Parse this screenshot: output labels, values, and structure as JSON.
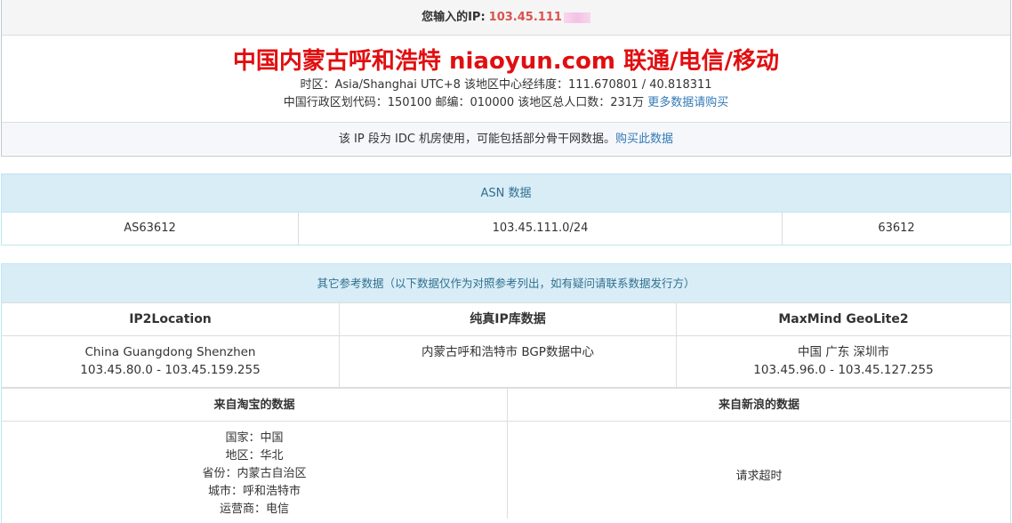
{
  "ip_header": {
    "label": "您输入的IP:",
    "value": "103.45.111"
  },
  "location": {
    "title": "中国内蒙古呼和浩特 niaoyun.com 联通/电信/移动",
    "timezone_line": "时区：Asia/Shanghai UTC+8 该地区中心经纬度：111.670801 / 40.818311",
    "code_line": "中国行政区划代码：150100 邮编：010000 该地区总人口数：231万",
    "more_link": "更多数据请购买"
  },
  "idc_note": {
    "text": "该 IP 段为 IDC 机房使用，可能包括部分骨干网数据。",
    "link": "购买此数据"
  },
  "asn": {
    "heading": "ASN 数据",
    "cells": [
      "AS63612",
      "103.45.111.0/24",
      "63612"
    ]
  },
  "reference": {
    "heading": "其它参考数据（以下数据仅作为对照参考列出，如有疑问请联系数据发行方）",
    "columns": [
      {
        "title": "IP2Location",
        "lines": [
          "China Guangdong Shenzhen",
          "103.45.80.0 - 103.45.159.255"
        ]
      },
      {
        "title": "纯真IP库数据",
        "lines": [
          "内蒙古呼和浩特市 BGP数据中心"
        ]
      },
      {
        "title": "MaxMind GeoLite2",
        "lines": [
          "中国 广东 深圳市",
          "103.45.96.0 - 103.45.127.255"
        ]
      }
    ],
    "taobao": {
      "title": "来自淘宝的数据",
      "lines": [
        "国家：中国",
        "地区：华北",
        "省份：内蒙古自治区",
        "城市：呼和浩特市",
        "运营商：电信"
      ]
    },
    "sina": {
      "title": "来自新浪的数据",
      "text": "请求超时"
    }
  },
  "colors": {
    "title_red": "#e10e10",
    "ip_red": "#d9534f",
    "link_blue": "#337ab7",
    "panel_info_bg": "#d9edf7",
    "panel_info_text": "#31708f"
  }
}
